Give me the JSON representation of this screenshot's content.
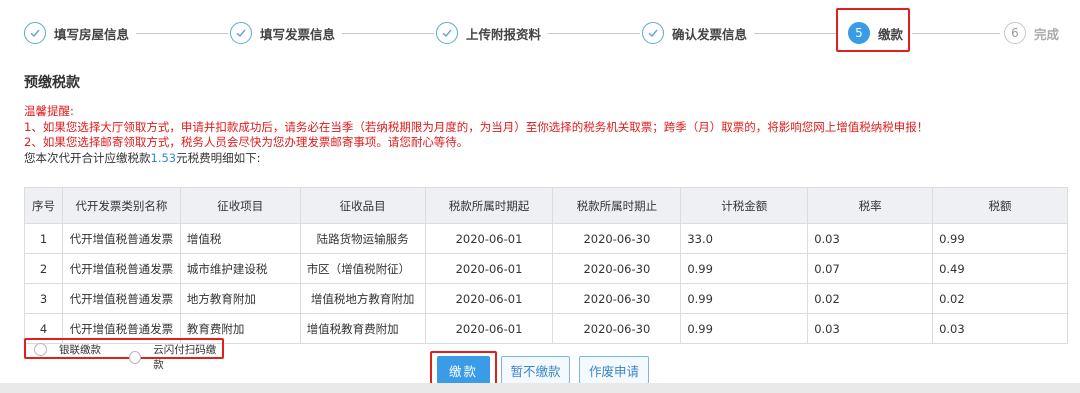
{
  "stepper": {
    "steps": [
      {
        "label": "填写房屋信息",
        "number": "",
        "state": "done"
      },
      {
        "label": "填写发票信息",
        "number": "",
        "state": "done"
      },
      {
        "label": "上传附报资料",
        "number": "",
        "state": "done"
      },
      {
        "label": "确认发票信息",
        "number": "",
        "state": "done"
      },
      {
        "label": "缴款",
        "number": "5",
        "state": "active"
      },
      {
        "label": "完成",
        "number": "6",
        "state": "todo"
      }
    ]
  },
  "section": {
    "title": "预缴税款"
  },
  "notice": {
    "heading": "温馨提醒:",
    "line1": "1、如果您选择大厅领取方式，申请并扣款成功后，请务必在当季（若纳税期限为月度的，为当月）至你选择的税务机关取票；跨季（月）取票的，将影响您网上增值税纳税申报！",
    "line2": "2、如果您选择邮寄领取方式，税务人员会尽快为您办理发票邮寄事项。请您耐心等待。",
    "summary_prefix": "您本次代开合计应缴税款",
    "summary_amount": "1.53",
    "summary_suffix": "元税费明细如下:"
  },
  "table": {
    "headers": [
      "序号",
      "代开发票类别名称",
      "征收项目",
      "征收品目",
      "税款所属时期起",
      "税款所属时期止",
      "计税金额",
      "税率",
      "税额"
    ],
    "rows": [
      [
        "1",
        "代开增值税普通发票",
        "增值税",
        "陆路货物运输服务",
        "2020-06-01",
        "2020-06-30",
        "33.0",
        "0.03",
        "0.99"
      ],
      [
        "2",
        "代开增值税普通发票",
        "城市维护建设税",
        "市区（增值税附征）",
        "2020-06-01",
        "2020-06-30",
        "0.99",
        "0.07",
        "0.49"
      ],
      [
        "3",
        "代开增值税普通发票",
        "地方教育附加",
        "增值税地方教育附加",
        "2020-06-01",
        "2020-06-30",
        "0.99",
        "0.02",
        "0.02"
      ],
      [
        "4",
        "代开增值税普通发票",
        "教育费附加",
        "增值税教育费附加",
        "2020-06-01",
        "2020-06-30",
        "0.99",
        "0.03",
        "0.03"
      ]
    ]
  },
  "payment": {
    "options": [
      "银联缴款",
      "云闪付扫码缴款"
    ]
  },
  "actions": {
    "pay": "缴款",
    "defer": "暂不缴款",
    "void": "作废申请"
  },
  "colors": {
    "accent": "#3a9be6",
    "warning": "#e11b1b",
    "highlight_border": "#e02020"
  }
}
